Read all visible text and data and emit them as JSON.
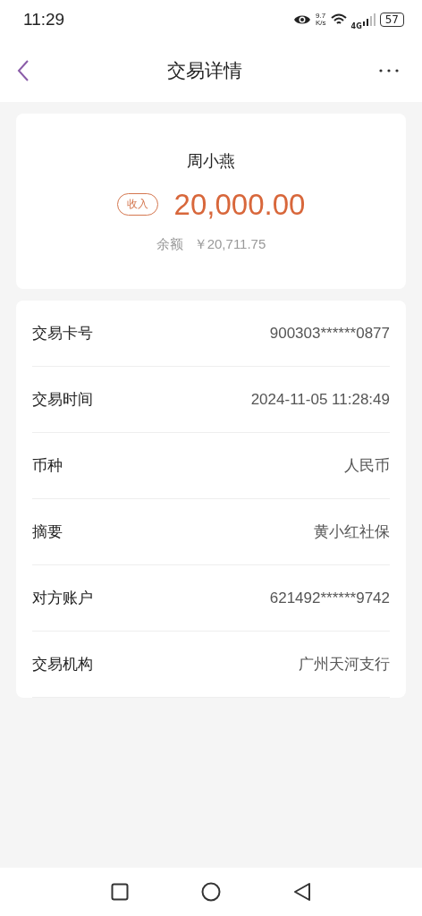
{
  "status_bar": {
    "time": "11:29",
    "speed_value": "9.7",
    "speed_unit": "K/s",
    "network": "4G",
    "battery": "57"
  },
  "header": {
    "title": "交易详情"
  },
  "summary": {
    "name": "周小燕",
    "tag": "收入",
    "amount": "20,000.00",
    "balance_label": "余额",
    "balance": "￥20,711.75"
  },
  "details": [
    {
      "label": "交易卡号",
      "value": "900303******0877"
    },
    {
      "label": "交易时间",
      "value": "2024-11-05 11:28:49"
    },
    {
      "label": "币种",
      "value": "人民币"
    },
    {
      "label": "摘要",
      "value": "黄小红社保"
    },
    {
      "label": "对方账户",
      "value": "621492******9742"
    },
    {
      "label": "交易机构",
      "value": "广州天河支行"
    }
  ]
}
